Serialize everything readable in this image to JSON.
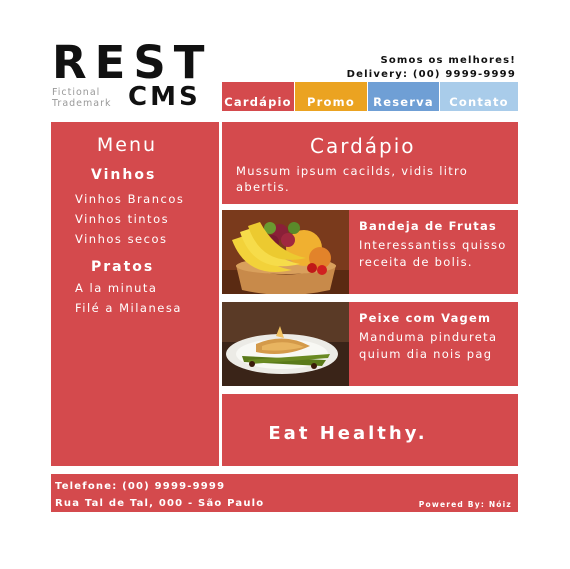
{
  "logo": {
    "main": "REST",
    "sub_line1": "Fictional",
    "sub_line2": "Trademark",
    "cms": "CMS"
  },
  "tagline": {
    "line1": "Somos os melhores!",
    "line2": "Delivery: (00) 9999-9999"
  },
  "nav": {
    "tabs": [
      {
        "label": "Cardápio",
        "color": "#d44a4d"
      },
      {
        "label": "Promo",
        "color": "#eba321"
      },
      {
        "label": "Reserva",
        "color": "#6f9fd5"
      },
      {
        "label": "Contato",
        "color": "#a9ccea"
      }
    ]
  },
  "sidebar": {
    "title": "Menu",
    "sections": [
      {
        "heading": "Vinhos",
        "items": [
          "Vinhos Brancos",
          "Vinhos tintos",
          "Vinhos secos"
        ]
      },
      {
        "heading": "Pratos",
        "items": [
          "A la minuta",
          "Filé a Milanesa"
        ]
      }
    ]
  },
  "intro": {
    "title": "Cardápio",
    "text": "Mussum ipsum cacilds, vidis litro abertis."
  },
  "cards": [
    {
      "title": "Bandeja de Frutas",
      "line1": "Interessantiss quisso",
      "line2": "receita de bolis.",
      "image": "fruit-bowl-photo"
    },
    {
      "title": "Peixe com Vagem",
      "line1": "Manduma pindureta",
      "line2": "quium dia nois pag",
      "image": "fish-dish-photo"
    }
  ],
  "banner": {
    "text": "Eat Healthy."
  },
  "footer": {
    "phone": "Telefone: (00) 9999-9999",
    "address": "Rua Tal de Tal, 000 - São Paulo",
    "powered": "Powered By: Nóiz"
  },
  "colors": {
    "accent": "#d44a4d",
    "promo": "#eba321",
    "reserva": "#6f9fd5",
    "contato": "#a9ccea"
  }
}
